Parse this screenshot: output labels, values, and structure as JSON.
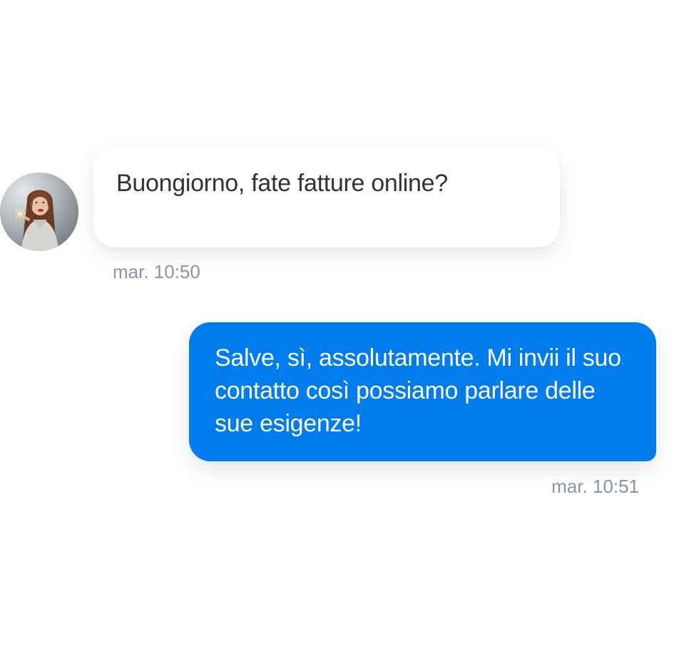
{
  "conversation": {
    "incoming": {
      "text": "Buongiorno, fate fatture online?",
      "time": "mar. 10:50",
      "avatar_icon": "user-avatar-photo"
    },
    "outgoing": {
      "text": "Salve, sì, assolutamente. Mi invii il suo contatto così possiamo parlare delle sue esigenze!",
      "time": "mar. 10:51"
    }
  },
  "colors": {
    "outgoing_bubble": "#017cec",
    "incoming_bubble": "#ffffff",
    "timestamp": "#8a94a3",
    "incoming_text": "#2f3338"
  }
}
